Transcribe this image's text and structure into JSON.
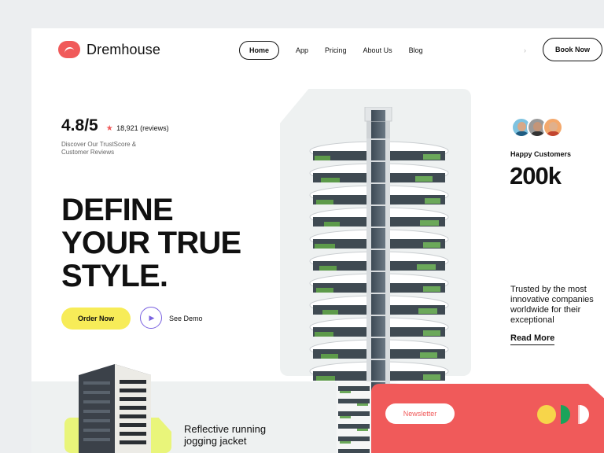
{
  "brand": {
    "name": "Dremhouse",
    "color": "#f05a5a"
  },
  "nav": {
    "items": [
      {
        "label": "Home",
        "active": true
      },
      {
        "label": "App"
      },
      {
        "label": "Pricing"
      },
      {
        "label": "About Us"
      },
      {
        "label": "Blog"
      }
    ],
    "chevron_icon": "chevron-right-icon",
    "cta_label": "Book Now"
  },
  "rating": {
    "score": "4.8/5",
    "star_icon": "star-icon",
    "count": "18,921 (reviews)",
    "subtitle": "Discover Our TrustScore & Customer Reviews"
  },
  "hero": {
    "headline_lines": [
      "DEFINE",
      "YOUR TRUE",
      "STYLE."
    ],
    "order_label": "Order Now",
    "demo_label": "See Demo",
    "play_icon": "play-icon"
  },
  "stats": {
    "happy_label": "Happy Customers",
    "happy_value": "200k",
    "trust_text": "Trusted by the most innovative companies worldwide for their exceptional",
    "read_more": "Read More"
  },
  "product": {
    "title_lines": [
      "Reflective running",
      "jogging jacket"
    ]
  },
  "newsletter": {
    "label": "Newsletter"
  },
  "colors": {
    "accent_red": "#f05a5a",
    "accent_yellow": "#f7ec58",
    "accent_lime": "#e9f57a",
    "accent_purple": "#7a62e0",
    "dot_yellow": "#f7d54a",
    "dot_green": "#1aa35a",
    "dot_white": "#ffffff"
  }
}
